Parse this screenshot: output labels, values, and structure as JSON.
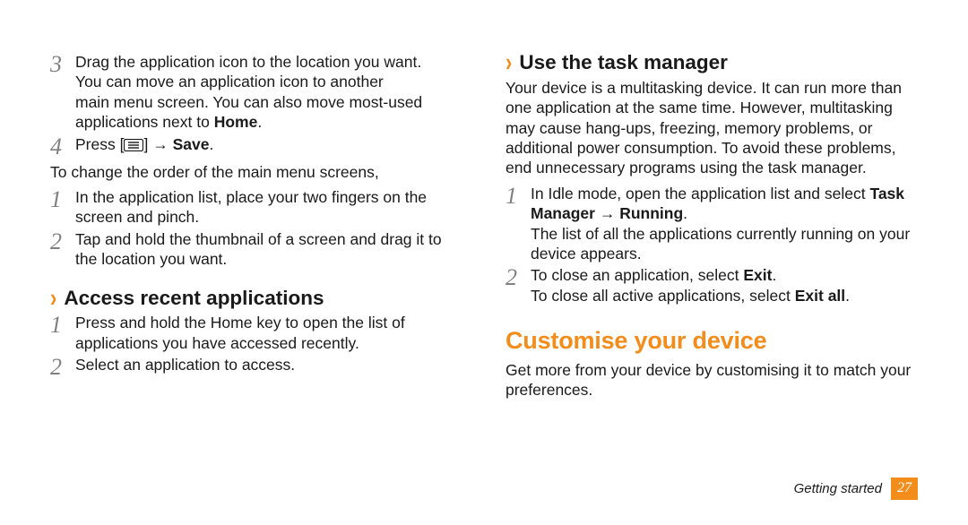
{
  "left": {
    "step3": "Drag the application icon to the location you want.",
    "step3_more": [
      "You can move an application icon to another",
      "main menu screen. You can also move most-used",
      "applications next to "
    ],
    "step3_bold_end": "Home",
    "step4_prefix": "Press [",
    "step4_suffix": "] → ",
    "step4_bold": "Save",
    "intro2": "To change the order of the main menu screens,",
    "sub_step1": "In the application list, place your two fingers on the screen and pinch.",
    "sub_step2": "Tap and hold the thumbnail of a screen and drag it to the location you want.",
    "sub_h1": "Access recent applications",
    "r_step1": "Press and hold the Home key to open the list of applications you have accessed recently.",
    "r_step2": "Select an application to access."
  },
  "right": {
    "sub_h": "Use the task manager",
    "intro": "Your device is a multitasking device. It can run more than one application at the same time. However, multitasking may cause hang-ups, freezing, memory problems, or additional power consumption. To avoid these problems, end unnecessary programs using the task manager.",
    "step1_pre": "In Idle mode, open the application list and select ",
    "step1_b1": "Task Manager",
    "step1_mid": " → ",
    "step1_b2": "Running",
    "step1_more": "The list of all the applications currently running on your device appears.",
    "step2_pre": "To close an application, select ",
    "step2_b": "Exit",
    "step2_more_pre": "To close all active applications, select ",
    "step2_more_b": "Exit all",
    "section_h": "Customise your device",
    "section_intro": "Get more from your device by customising it to match your preferences."
  },
  "footer": {
    "section": "Getting started",
    "page": "27"
  }
}
